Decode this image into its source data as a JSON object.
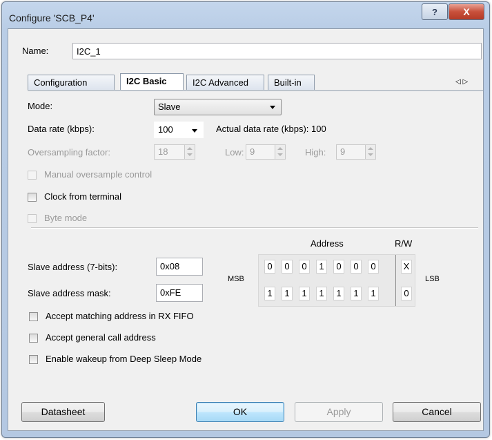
{
  "window": {
    "title": "Configure 'SCB_P4'",
    "help_label": "?",
    "close_label": "X"
  },
  "name": {
    "label": "Name:",
    "value": "I2C_1"
  },
  "tabs": [
    {
      "label": "Configuration",
      "active": false
    },
    {
      "label": "I2C Basic",
      "active": true
    },
    {
      "label": "I2C Advanced",
      "active": false
    },
    {
      "label": "Built-in",
      "active": false
    }
  ],
  "tab_scroll": {
    "left": "◁",
    "right": "▷"
  },
  "mode": {
    "label": "Mode:",
    "value": "Slave"
  },
  "data_rate": {
    "label": "Data rate (kbps):",
    "value": "100",
    "actual_label": "Actual data rate (kbps): 100"
  },
  "oversampling": {
    "label": "Oversampling factor:",
    "value": "18",
    "low_label": "Low:",
    "low_value": "9",
    "high_label": "High:",
    "high_value": "9"
  },
  "options": {
    "manual_oversample": {
      "label": "Manual oversample control",
      "checked": false,
      "enabled": false
    },
    "clock_from_terminal": {
      "label": "Clock from terminal",
      "checked": false,
      "enabled": true
    },
    "byte_mode": {
      "label": "Byte mode",
      "checked": false,
      "enabled": false
    }
  },
  "address": {
    "header_address": "Address",
    "header_rw": "R/W",
    "msb_label": "MSB",
    "lsb_label": "LSB",
    "slave_address_label": "Slave address (7-bits):",
    "slave_address_value": "0x08",
    "mask_label": "Slave address mask:",
    "mask_value": "0xFE",
    "address_bits": [
      "0",
      "0",
      "0",
      "1",
      "0",
      "0",
      "0",
      "X"
    ],
    "mask_bits": [
      "1",
      "1",
      "1",
      "1",
      "1",
      "1",
      "1",
      "0"
    ]
  },
  "checks": {
    "accept_matching": {
      "label": "Accept matching address in RX FIFO",
      "checked": false
    },
    "accept_general_call": {
      "label": "Accept general call address",
      "checked": false
    },
    "enable_wakeup": {
      "label": "Enable wakeup from Deep Sleep Mode",
      "checked": false
    }
  },
  "buttons": {
    "datasheet": "Datasheet",
    "ok": "OK",
    "apply": "Apply",
    "cancel": "Cancel"
  }
}
